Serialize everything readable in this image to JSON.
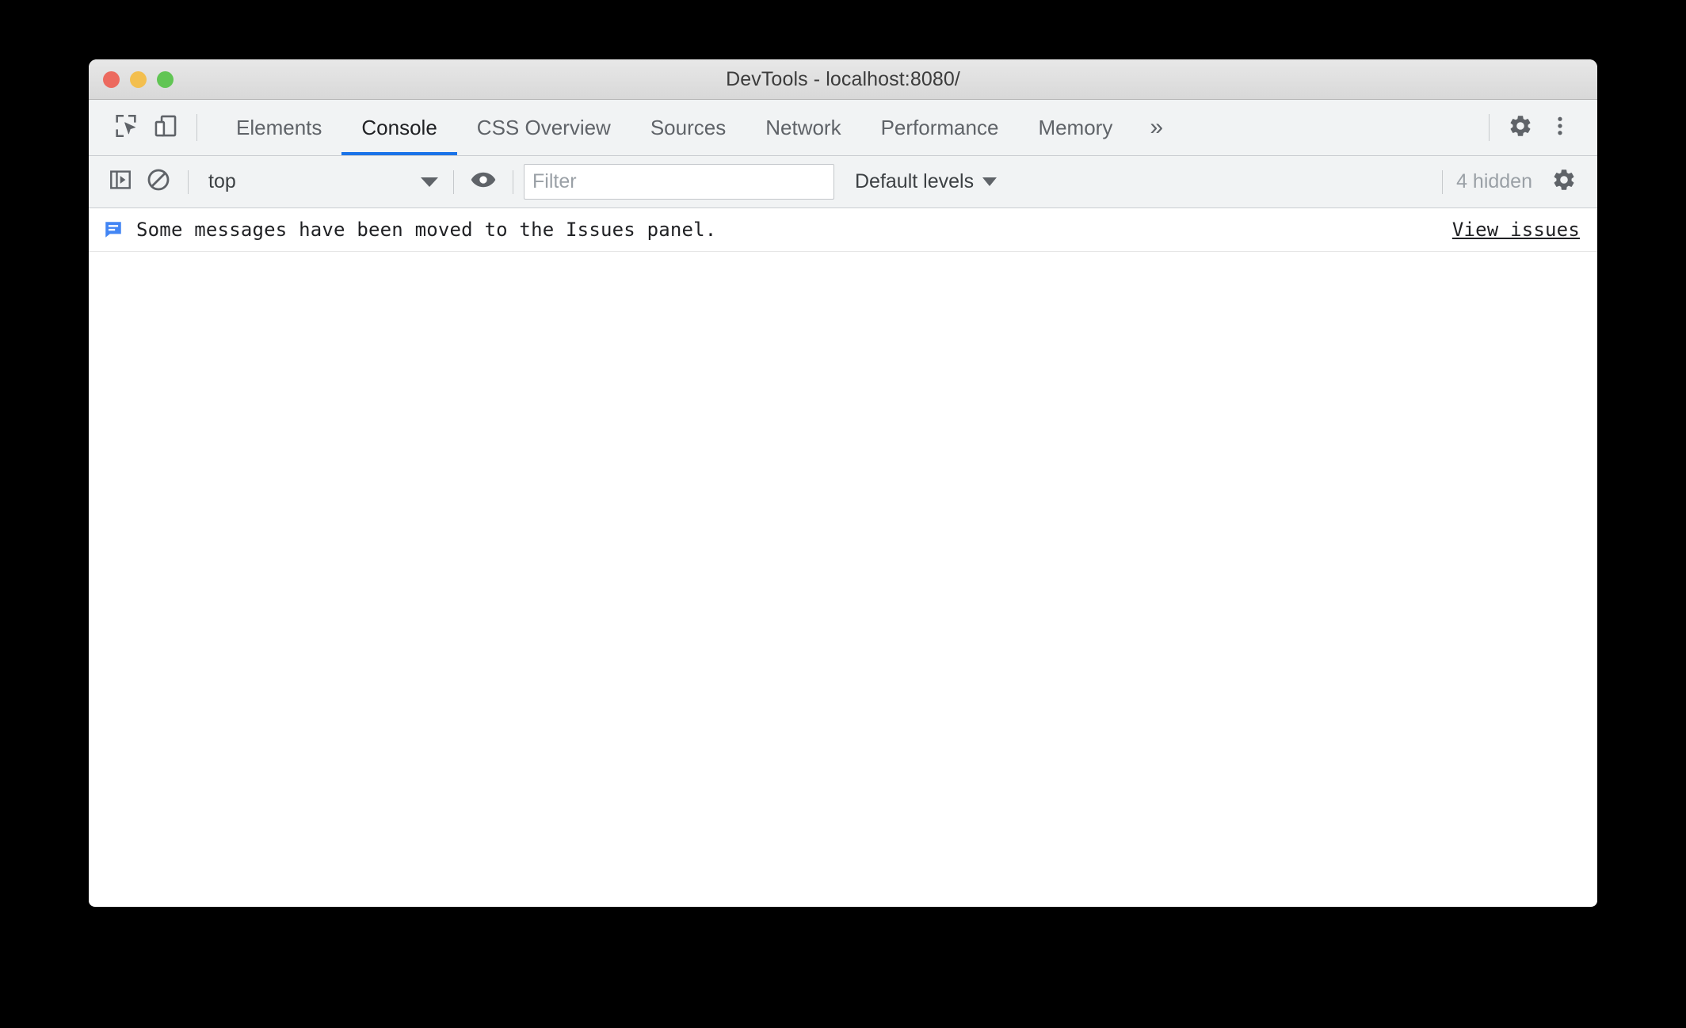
{
  "window": {
    "title": "DevTools - localhost:8080/",
    "traffic_lights": [
      {
        "name": "close",
        "color": "#ec6a5f"
      },
      {
        "name": "minimize",
        "color": "#f3bf4f"
      },
      {
        "name": "maximize",
        "color": "#61c554"
      }
    ]
  },
  "tabbar": {
    "inspect_icon": "inspect-element-icon",
    "device_icon": "device-toolbar-icon",
    "tabs": [
      {
        "label": "Elements",
        "active": false
      },
      {
        "label": "Console",
        "active": true
      },
      {
        "label": "CSS Overview",
        "active": false
      },
      {
        "label": "Sources",
        "active": false
      },
      {
        "label": "Network",
        "active": false
      },
      {
        "label": "Performance",
        "active": false
      },
      {
        "label": "Memory",
        "active": false
      }
    ],
    "more_tabs_label": "»",
    "settings_icon": "gear-icon",
    "menu_icon": "more-vertical-icon",
    "active_tab_color": "#1a73e8"
  },
  "console_toolbar": {
    "sidebar_icon": "console-sidebar-icon",
    "clear_icon": "clear-console-icon",
    "context": {
      "value": "top",
      "caret": "chevron-down-icon"
    },
    "eye_icon": "live-expression-eye-icon",
    "filter": {
      "value": "",
      "placeholder": "Filter"
    },
    "levels": {
      "value": "Default levels",
      "caret": "chevron-down-icon"
    },
    "hidden_count": "4 hidden",
    "settings_icon": "console-settings-gear-icon"
  },
  "console": {
    "messages": [
      {
        "icon": "issue-message-icon",
        "icon_color": "#4285f4",
        "text": "Some messages have been moved to the Issues panel.",
        "link": "View issues"
      }
    ]
  }
}
